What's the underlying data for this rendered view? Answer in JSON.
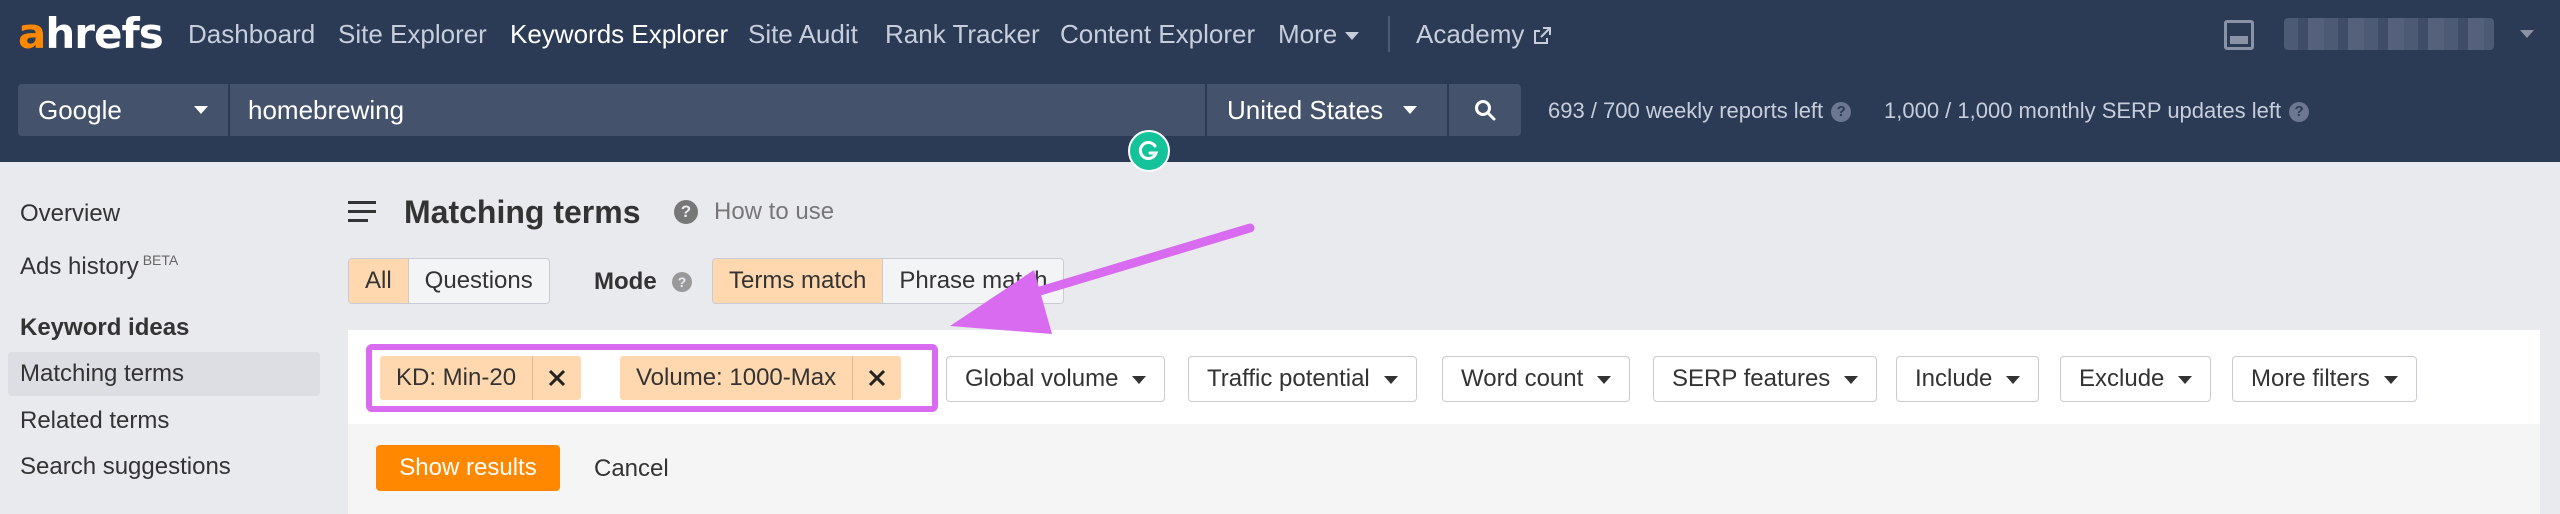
{
  "brand": {
    "logo_a": "a",
    "logo_rest": "hrefs"
  },
  "nav": {
    "dashboard": "Dashboard",
    "site_explorer": "Site Explorer",
    "keywords_explorer": "Keywords Explorer",
    "site_audit": "Site Audit",
    "rank_tracker": "Rank Tracker",
    "content_explorer": "Content Explorer",
    "more": "More",
    "academy": "Academy"
  },
  "search": {
    "engine": "Google",
    "query": "homebrewing",
    "country": "United States"
  },
  "quota": {
    "weekly": "693 / 700 weekly reports left",
    "monthly": "1,000 / 1,000 monthly SERP updates left"
  },
  "sidebar": {
    "overview": "Overview",
    "ads_history": "Ads history",
    "ads_badge": "BETA",
    "keyword_ideas": "Keyword ideas",
    "matching_terms": "Matching terms",
    "related_terms": "Related terms",
    "search_suggestions": "Search suggestions"
  },
  "main": {
    "title": "Matching terms",
    "how_to": "How to use",
    "tabs": [
      "All",
      "Questions"
    ],
    "mode_label": "Mode",
    "modes": [
      "Terms match",
      "Phrase match"
    ]
  },
  "filters": {
    "active": [
      "KD: Min-20",
      "Volume: 1000-Max"
    ],
    "buttons": [
      "Global volume",
      "Traffic potential",
      "Word count",
      "SERP features",
      "Include",
      "Exclude",
      "More filters"
    ],
    "show_results": "Show results",
    "cancel": "Cancel"
  },
  "colors": {
    "accent": "#ff8800",
    "highlight": "#d86bef",
    "topbar": "#2b3a55"
  }
}
